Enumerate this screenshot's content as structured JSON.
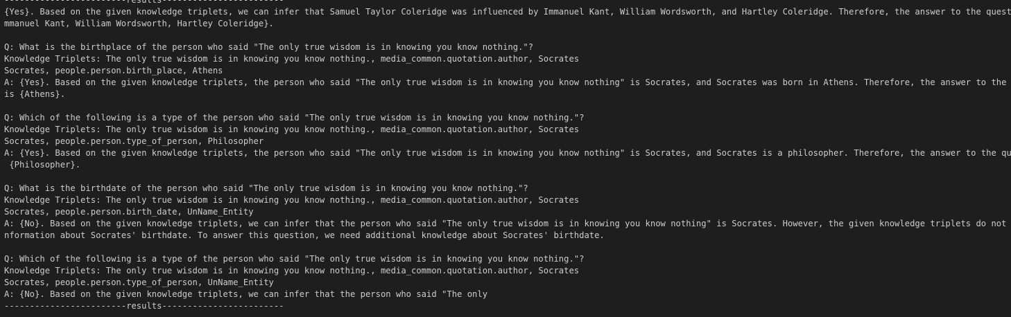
{
  "terminal": {
    "separator_top": "------------------------results------------------------",
    "separator_bottom": "------------------------results------------------------",
    "lines": [
      "{Yes}. Based on the given knowledge triplets, we can infer that Samuel Taylor Coleridge was influenced by Immanuel Kant, William Wordsworth, and Hartley Coleridge. Therefore, the answer to the question is {I",
      "mmanuel Kant, William Wordsworth, Hartley Coleridge}.",
      "",
      "Q: What is the birthplace of the person who said \"The only true wisdom is in knowing you know nothing.\"?",
      "Knowledge Triplets: The only true wisdom is in knowing you know nothing., media_common.quotation.author, Socrates",
      "Socrates, people.person.birth_place, Athens",
      "A: {Yes}. Based on the given knowledge triplets, the person who said \"The only true wisdom is in knowing you know nothing\" is Socrates, and Socrates was born in Athens. Therefore, the answer to the question",
      "is {Athens}.",
      "",
      "Q: Which of the following is a type of the person who said \"The only true wisdom is in knowing you know nothing.\"?",
      "Knowledge Triplets: The only true wisdom is in knowing you know nothing., media_common.quotation.author, Socrates",
      "Socrates, people.person.type_of_person, Philosopher",
      "A: {Yes}. Based on the given knowledge triplets, the person who said \"The only true wisdom is in knowing you know nothing\" is Socrates, and Socrates is a philosopher. Therefore, the answer to the question is",
      " {Philosopher}.",
      "",
      "Q: What is the birthdate of the person who said \"The only true wisdom is in knowing you know nothing.\"?",
      "Knowledge Triplets: The only true wisdom is in knowing you know nothing., media_common.quotation.author, Socrates",
      "Socrates, people.person.birth_date, UnName_Entity",
      "A: {No}. Based on the given knowledge triplets, we can infer that the person who said \"The only true wisdom is in knowing you know nothing\" is Socrates. However, the given knowledge triplets do not provide i",
      "nformation about Socrates' birthdate. To answer this question, we need additional knowledge about Socrates' birthdate.",
      "",
      "Q: Which of the following is a type of the person who said \"The only true wisdom is in knowing you know nothing.\"?",
      "Knowledge Triplets: The only true wisdom is in knowing you know nothing., media_common.quotation.author, Socrates",
      "Socrates, people.person.type_of_person, UnName_Entity",
      "A: {No}. Based on the given knowledge triplets, we can infer that the person who said \"The only"
    ]
  }
}
